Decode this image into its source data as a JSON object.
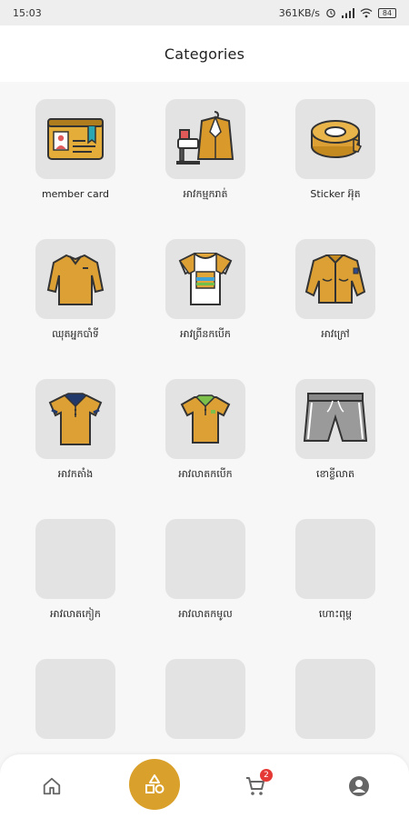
{
  "status_bar": {
    "time": "15:03",
    "network_speed": "361KB/s",
    "battery": "84"
  },
  "header": {
    "title": "Categories"
  },
  "categories": [
    {
      "label": "member card",
      "icon": "member-card-icon"
    },
    {
      "label": "អាវកម្មករាត់",
      "icon": "tailor-sewing-icon"
    },
    {
      "label": "Sticker អ៊ុត",
      "icon": "tape-roll-icon"
    },
    {
      "label": "ឈុតអ្នកបាំទី",
      "icon": "long-sleeve-shirt-icon"
    },
    {
      "label": "អាវព្រីនកបើក",
      "icon": "printed-tshirt-icon"
    },
    {
      "label": "អាវក្រៅ",
      "icon": "jacket-icon"
    },
    {
      "label": "អាវកតាំង",
      "icon": "polo-navy-collar-icon"
    },
    {
      "label": "អាវលាតកបើក",
      "icon": "polo-green-collar-icon"
    },
    {
      "label": "ខោខ្លីលាត",
      "icon": "shorts-icon"
    },
    {
      "label": "អាវលាតកៀក",
      "icon": ""
    },
    {
      "label": "អាវលាតកមូល",
      "icon": ""
    },
    {
      "label": "ហោះពុម្ព",
      "icon": ""
    },
    {
      "label": "",
      "icon": ""
    },
    {
      "label": "",
      "icon": ""
    },
    {
      "label": "",
      "icon": ""
    }
  ],
  "bottom_nav": {
    "items": [
      "home-icon",
      "categories-shapes-icon",
      "cart-icon",
      "profile-icon"
    ],
    "cart_badge": "2",
    "accent_color": "#d9a12c"
  }
}
